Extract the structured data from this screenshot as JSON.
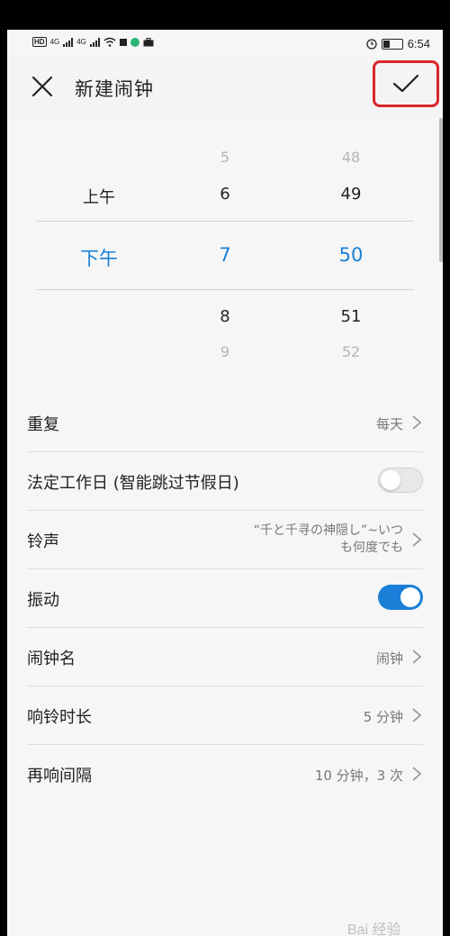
{
  "status_bar": {
    "hd_badge": "HD",
    "network_1": "4G",
    "network_2": "4G",
    "time": "6:54"
  },
  "header": {
    "title": "新建闹钟"
  },
  "picker": {
    "ampm": {
      "above": "上午",
      "selected": "下午"
    },
    "hour": {
      "above2": "5",
      "above1": "6",
      "selected": "7",
      "below1": "8",
      "below2": "9"
    },
    "minute": {
      "above2": "48",
      "above1": "49",
      "selected": "50",
      "below1": "51",
      "below2": "52"
    },
    "selected_color": "#1a7fd6"
  },
  "settings": {
    "repeat": {
      "label": "重复",
      "value": "每天"
    },
    "workday": {
      "label": "法定工作日 (智能跳过节假日)",
      "enabled": false
    },
    "ringtone": {
      "label": "铃声",
      "value_line1": "“千と千寻の神隠し”~いつ",
      "value_line2": "も何度でも"
    },
    "vibrate": {
      "label": "振动",
      "enabled": true
    },
    "alarm_name": {
      "label": "闹钟名",
      "value": "闹钟"
    },
    "ring_duration": {
      "label": "响铃时长",
      "value": "5 分钟"
    },
    "snooze": {
      "label": "再响间隔",
      "value": "10 分钟，3 次"
    }
  },
  "colors": {
    "accent": "#1a7fd6",
    "highlight_border": "#d9272a"
  },
  "watermark": {
    "text": "Bai 经验"
  }
}
